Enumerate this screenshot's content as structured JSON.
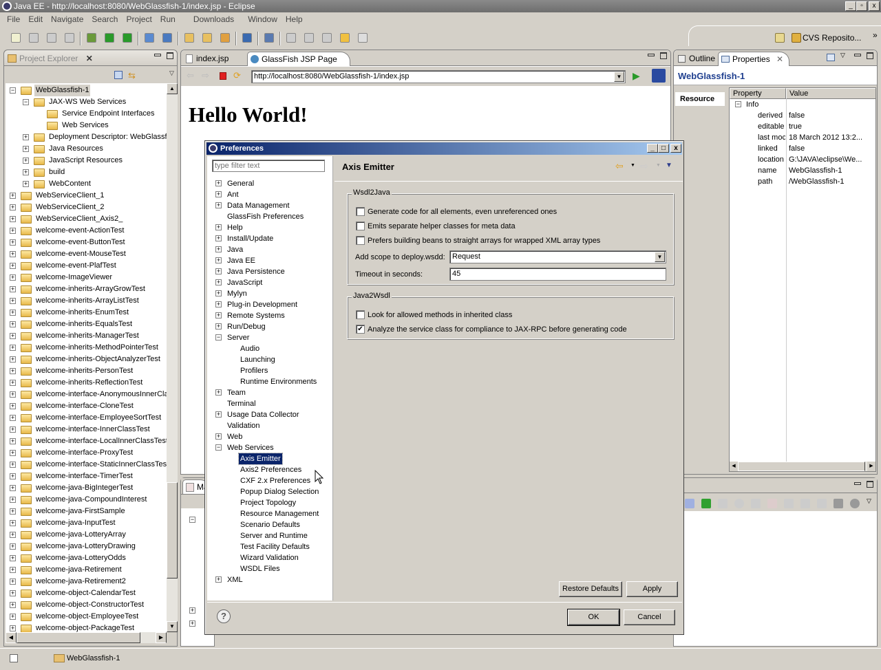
{
  "window": {
    "title": "Java EE - http://localhost:8080/WebGlassfish-1/index.jsp - Eclipse",
    "controls": [
      "_",
      "▫",
      "x"
    ]
  },
  "menu": [
    "File",
    "Edit",
    "Navigate",
    "Search",
    "Project",
    "Run",
    "Downloads",
    "Window",
    "Help"
  ],
  "perspectives": {
    "cvs_label": "CVS Reposito...",
    "more": "»"
  },
  "project_explorer": {
    "tab_label": "Project Explorer",
    "items": [
      {
        "label": "WebGlassfish-1",
        "level": 0,
        "state": "open",
        "selected": true
      },
      {
        "label": "JAX-WS Web Services",
        "level": 1,
        "state": "open"
      },
      {
        "label": "Service Endpoint Interfaces",
        "level": 2,
        "state": "none"
      },
      {
        "label": "Web Services",
        "level": 2,
        "state": "none"
      },
      {
        "label": "Deployment Descriptor: WebGlassfis",
        "level": 1,
        "state": "closed"
      },
      {
        "label": "Java Resources",
        "level": 1,
        "state": "closed"
      },
      {
        "label": "JavaScript Resources",
        "level": 1,
        "state": "closed"
      },
      {
        "label": "build",
        "level": 1,
        "state": "closed"
      },
      {
        "label": "WebContent",
        "level": 1,
        "state": "closed"
      },
      {
        "label": "WebServiceClient_1",
        "level": 0,
        "state": "closed"
      },
      {
        "label": "WebServiceClient_2",
        "level": 0,
        "state": "closed"
      },
      {
        "label": "WebServiceClient_Axis2_",
        "level": 0,
        "state": "closed"
      },
      {
        "label": "welcome-event-ActionTest",
        "level": 0,
        "state": "closed"
      },
      {
        "label": "welcome-event-ButtonTest",
        "level": 0,
        "state": "closed"
      },
      {
        "label": "welcome-event-MouseTest",
        "level": 0,
        "state": "closed"
      },
      {
        "label": "welcome-event-PlafTest",
        "level": 0,
        "state": "closed"
      },
      {
        "label": "welcome-ImageViewer",
        "level": 0,
        "state": "closed"
      },
      {
        "label": "welcome-inherits-ArrayGrowTest",
        "level": 0,
        "state": "closed"
      },
      {
        "label": "welcome-inherits-ArrayListTest",
        "level": 0,
        "state": "closed"
      },
      {
        "label": "welcome-inherits-EnumTest",
        "level": 0,
        "state": "closed"
      },
      {
        "label": "welcome-inherits-EqualsTest",
        "level": 0,
        "state": "closed"
      },
      {
        "label": "welcome-inherits-ManagerTest",
        "level": 0,
        "state": "closed"
      },
      {
        "label": "welcome-inherits-MethodPointerTest",
        "level": 0,
        "state": "closed"
      },
      {
        "label": "welcome-inherits-ObjectAnalyzerTest",
        "level": 0,
        "state": "closed"
      },
      {
        "label": "welcome-inherits-PersonTest",
        "level": 0,
        "state": "closed"
      },
      {
        "label": "welcome-inherits-ReflectionTest",
        "level": 0,
        "state": "closed"
      },
      {
        "label": "welcome-interface-AnonymousInnerCla",
        "level": 0,
        "state": "closed"
      },
      {
        "label": "welcome-interface-CloneTest",
        "level": 0,
        "state": "closed"
      },
      {
        "label": "welcome-interface-EmployeeSortTest",
        "level": 0,
        "state": "closed"
      },
      {
        "label": "welcome-interface-InnerClassTest",
        "level": 0,
        "state": "closed"
      },
      {
        "label": "welcome-interface-LocalInnerClassTest",
        "level": 0,
        "state": "closed"
      },
      {
        "label": "welcome-interface-ProxyTest",
        "level": 0,
        "state": "closed"
      },
      {
        "label": "welcome-interface-StaticInnerClassTest",
        "level": 0,
        "state": "closed"
      },
      {
        "label": "welcome-interface-TimerTest",
        "level": 0,
        "state": "closed"
      },
      {
        "label": "welcome-java-BigIntegerTest",
        "level": 0,
        "state": "closed"
      },
      {
        "label": "welcome-java-CompoundInterest",
        "level": 0,
        "state": "closed"
      },
      {
        "label": "welcome-java-FirstSample",
        "level": 0,
        "state": "closed"
      },
      {
        "label": "welcome-java-InputTest",
        "level": 0,
        "state": "closed"
      },
      {
        "label": "welcome-java-LotteryArray",
        "level": 0,
        "state": "closed"
      },
      {
        "label": "welcome-java-LotteryDrawing",
        "level": 0,
        "state": "closed"
      },
      {
        "label": "welcome-java-LotteryOdds",
        "level": 0,
        "state": "closed"
      },
      {
        "label": "welcome-java-Retirement",
        "level": 0,
        "state": "closed"
      },
      {
        "label": "welcome-java-Retirement2",
        "level": 0,
        "state": "closed"
      },
      {
        "label": "welcome-object-CalendarTest",
        "level": 0,
        "state": "closed"
      },
      {
        "label": "welcome-object-ConstructorTest",
        "level": 0,
        "state": "closed"
      },
      {
        "label": "welcome-object-EmployeeTest",
        "level": 0,
        "state": "closed"
      },
      {
        "label": "welcome-object-PackageTest",
        "level": 0,
        "state": "closed"
      }
    ]
  },
  "editor": {
    "tabs": [
      {
        "label": "index.jsp",
        "active": false
      },
      {
        "label": "GlassFish JSP Page",
        "active": true
      }
    ],
    "url": "http://localhost:8080/WebGlassfish-1/index.jsp",
    "heading": "Hello World!"
  },
  "lower_left": {
    "tab_label": "Ma"
  },
  "properties": {
    "tabs": [
      {
        "label": "Outline"
      },
      {
        "label": "Properties"
      }
    ],
    "title": "WebGlassfish-1",
    "section_tab": "Resource",
    "columns": [
      "Property",
      "Value"
    ],
    "group": "Info",
    "rows": [
      {
        "property": "derived",
        "value": "false"
      },
      {
        "property": "editable",
        "value": "true"
      },
      {
        "property": "last moc",
        "value": "18 March 2012 13:2..."
      },
      {
        "property": "linked",
        "value": "false"
      },
      {
        "property": "location",
        "value": "G:\\JAVA\\eclipse\\We..."
      },
      {
        "property": "name",
        "value": "WebGlassfish-1"
      },
      {
        "property": "path",
        "value": "/WebGlassfish-1"
      }
    ]
  },
  "status_bar": {
    "selection": "WebGlassfish-1"
  },
  "preferences": {
    "title": "Preferences",
    "filter_placeholder": "type filter text",
    "tree": [
      {
        "label": "General",
        "level": 0,
        "state": "closed"
      },
      {
        "label": "Ant",
        "level": 0,
        "state": "closed"
      },
      {
        "label": "Data Management",
        "level": 0,
        "state": "closed"
      },
      {
        "label": "GlassFish Preferences",
        "level": 0,
        "state": "none"
      },
      {
        "label": "Help",
        "level": 0,
        "state": "closed"
      },
      {
        "label": "Install/Update",
        "level": 0,
        "state": "closed"
      },
      {
        "label": "Java",
        "level": 0,
        "state": "closed"
      },
      {
        "label": "Java EE",
        "level": 0,
        "state": "closed"
      },
      {
        "label": "Java Persistence",
        "level": 0,
        "state": "closed"
      },
      {
        "label": "JavaScript",
        "level": 0,
        "state": "closed"
      },
      {
        "label": "Mylyn",
        "level": 0,
        "state": "closed"
      },
      {
        "label": "Plug-in Development",
        "level": 0,
        "state": "closed"
      },
      {
        "label": "Remote Systems",
        "level": 0,
        "state": "closed"
      },
      {
        "label": "Run/Debug",
        "level": 0,
        "state": "closed"
      },
      {
        "label": "Server",
        "level": 0,
        "state": "open"
      },
      {
        "label": "Audio",
        "level": 1,
        "state": "none"
      },
      {
        "label": "Launching",
        "level": 1,
        "state": "none"
      },
      {
        "label": "Profilers",
        "level": 1,
        "state": "none"
      },
      {
        "label": "Runtime Environments",
        "level": 1,
        "state": "none"
      },
      {
        "label": "Team",
        "level": 0,
        "state": "closed"
      },
      {
        "label": "Terminal",
        "level": 0,
        "state": "none"
      },
      {
        "label": "Usage Data Collector",
        "level": 0,
        "state": "closed"
      },
      {
        "label": "Validation",
        "level": 0,
        "state": "none"
      },
      {
        "label": "Web",
        "level": 0,
        "state": "closed"
      },
      {
        "label": "Web Services",
        "level": 0,
        "state": "open"
      },
      {
        "label": "Axis Emitter",
        "level": 1,
        "state": "none",
        "selected": true
      },
      {
        "label": "Axis2 Preferences",
        "level": 1,
        "state": "none"
      },
      {
        "label": "CXF 2.x Preferences",
        "level": 1,
        "state": "none"
      },
      {
        "label": "Popup Dialog Selection",
        "level": 1,
        "state": "none"
      },
      {
        "label": "Project Topology",
        "level": 1,
        "state": "none"
      },
      {
        "label": "Resource Management",
        "level": 1,
        "state": "none"
      },
      {
        "label": "Scenario Defaults",
        "level": 1,
        "state": "none"
      },
      {
        "label": "Server and Runtime",
        "level": 1,
        "state": "none"
      },
      {
        "label": "Test Facility Defaults",
        "level": 1,
        "state": "none"
      },
      {
        "label": "Wizard Validation",
        "level": 1,
        "state": "none"
      },
      {
        "label": "WSDL Files",
        "level": 1,
        "state": "none"
      },
      {
        "label": "XML",
        "level": 0,
        "state": "closed"
      }
    ],
    "page_title": "Axis Emitter",
    "wsdl2java": {
      "label": "Wsdl2Java",
      "options": [
        {
          "label": "Generate code for all elements, even unreferenced ones",
          "checked": false
        },
        {
          "label": "Emits separate helper classes for meta data",
          "checked": false
        },
        {
          "label": "Prefers building beans to straight arrays for wrapped XML array types",
          "checked": false
        }
      ],
      "scope_label": "Add scope to deploy.wsdd:",
      "scope_value": "Request",
      "timeout_label": "Timeout in seconds:",
      "timeout_value": "45"
    },
    "java2wsdl": {
      "label": "Java2Wsdl",
      "options": [
        {
          "label": "Look for allowed methods in inherited class",
          "checked": false
        },
        {
          "label": "Analyze the service class for compliance to JAX-RPC before generating code",
          "checked": true
        }
      ]
    },
    "buttons": {
      "restore": "Restore Defaults",
      "apply": "Apply",
      "ok": "OK",
      "cancel": "Cancel",
      "help": "?"
    }
  },
  "colors": {
    "dialog_title_start": "#0a246a",
    "dialog_title_end": "#a6caf0",
    "selection": "#0a246a",
    "properties_title": "#1f3f8f"
  }
}
